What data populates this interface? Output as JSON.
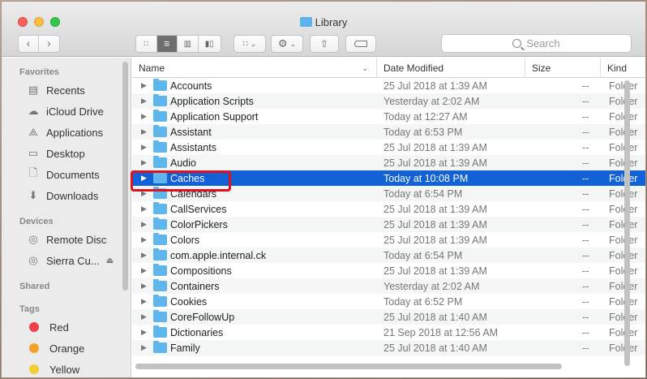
{
  "window": {
    "title": "Library"
  },
  "toolbar": {
    "back_icon": "chevron-left-icon",
    "forward_icon": "chevron-right-icon",
    "view_icons": [
      "icon-view-icon",
      "list-view-icon",
      "column-view-icon",
      "gallery-view-icon"
    ],
    "active_view": "list",
    "search_placeholder": "Search"
  },
  "sidebar": {
    "favorites_title": "Favorites",
    "favorites": [
      {
        "label": "Recents",
        "icon": "clock-icon"
      },
      {
        "label": "iCloud Drive",
        "icon": "cloud-icon"
      },
      {
        "label": "Applications",
        "icon": "applications-icon"
      },
      {
        "label": "Desktop",
        "icon": "desktop-icon"
      },
      {
        "label": "Documents",
        "icon": "document-icon"
      },
      {
        "label": "Downloads",
        "icon": "download-icon"
      }
    ],
    "devices_title": "Devices",
    "devices": [
      {
        "label": "Remote Disc",
        "icon": "disc-icon"
      },
      {
        "label": "Sierra Cu...",
        "icon": "disc-icon"
      }
    ],
    "shared_title": "Shared",
    "tags_title": "Tags",
    "tags": [
      {
        "label": "Red",
        "color": "#f0404a"
      },
      {
        "label": "Orange",
        "color": "#f6a02c"
      },
      {
        "label": "Yellow",
        "color": "#f5cd35"
      }
    ]
  },
  "list": {
    "columns": {
      "name": "Name",
      "date": "Date Modified",
      "size": "Size",
      "kind": "Kind"
    },
    "rows": [
      {
        "name": "Accounts",
        "date": "25 Jul 2018 at 1:39 AM",
        "size": "--",
        "kind": "Folder"
      },
      {
        "name": "Application Scripts",
        "date": "Yesterday at 2:02 AM",
        "size": "--",
        "kind": "Folder"
      },
      {
        "name": "Application Support",
        "date": "Today at 12:27 AM",
        "size": "--",
        "kind": "Folder"
      },
      {
        "name": "Assistant",
        "date": "Today at 6:53 PM",
        "size": "--",
        "kind": "Folder"
      },
      {
        "name": "Assistants",
        "date": "25 Jul 2018 at 1:39 AM",
        "size": "--",
        "kind": "Folder"
      },
      {
        "name": "Audio",
        "date": "25 Jul 2018 at 1:39 AM",
        "size": "--",
        "kind": "Folder"
      },
      {
        "name": "Caches",
        "date": "Today at 10:08 PM",
        "size": "--",
        "kind": "Folder",
        "selected": true
      },
      {
        "name": "Calendars",
        "date": "Today at 6:54 PM",
        "size": "--",
        "kind": "Folder"
      },
      {
        "name": "CallServices",
        "date": "25 Jul 2018 at 1:39 AM",
        "size": "--",
        "kind": "Folder"
      },
      {
        "name": "ColorPickers",
        "date": "25 Jul 2018 at 1:39 AM",
        "size": "--",
        "kind": "Folder"
      },
      {
        "name": "Colors",
        "date": "25 Jul 2018 at 1:39 AM",
        "size": "--",
        "kind": "Folder"
      },
      {
        "name": "com.apple.internal.ck",
        "date": "Today at 6:54 PM",
        "size": "--",
        "kind": "Folder"
      },
      {
        "name": "Compositions",
        "date": "25 Jul 2018 at 1:39 AM",
        "size": "--",
        "kind": "Folder"
      },
      {
        "name": "Containers",
        "date": "Yesterday at 2:02 AM",
        "size": "--",
        "kind": "Folder"
      },
      {
        "name": "Cookies",
        "date": "Today at 6:52 PM",
        "size": "--",
        "kind": "Folder"
      },
      {
        "name": "CoreFollowUp",
        "date": "25 Jul 2018 at 1:40 AM",
        "size": "--",
        "kind": "Folder"
      },
      {
        "name": "Dictionaries",
        "date": "21 Sep 2018 at 12:56 AM",
        "size": "--",
        "kind": "Folder"
      },
      {
        "name": "Family",
        "date": "25 Jul 2018 at 1:40 AM",
        "size": "--",
        "kind": "Folder"
      }
    ]
  },
  "accent_colors": {
    "selection": "#1261d6",
    "folder": "#5fb6ec",
    "highlight_box": "#e0101e"
  }
}
